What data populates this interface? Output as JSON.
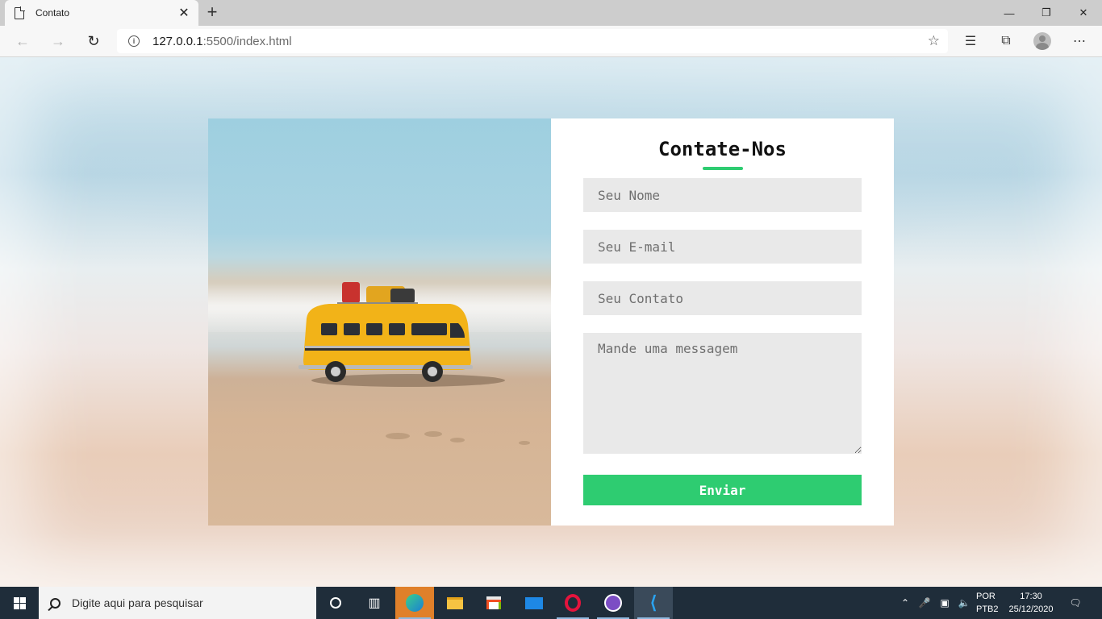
{
  "browser": {
    "tab_title": "Contato",
    "tab_close": "✕",
    "new_tab": "+",
    "url_host": "127.0.0.1",
    "url_rest": ":5500/index.html",
    "window_controls": {
      "minimize": "—",
      "maximize": "❐",
      "close": "✕"
    }
  },
  "contact_form": {
    "title": "Contate-Nos",
    "name_placeholder": "Seu Nome",
    "email_placeholder": "Seu E-mail",
    "phone_placeholder": "Seu Contato",
    "message_placeholder": "Mande uma messagem",
    "submit_label": "Enviar",
    "accent_color": "#2ecc71"
  },
  "taskbar": {
    "search_placeholder": "Digite aqui para pesquisar",
    "language_top": "POR",
    "language_bottom": "PTB2",
    "time": "17:30",
    "date": "25/12/2020"
  }
}
